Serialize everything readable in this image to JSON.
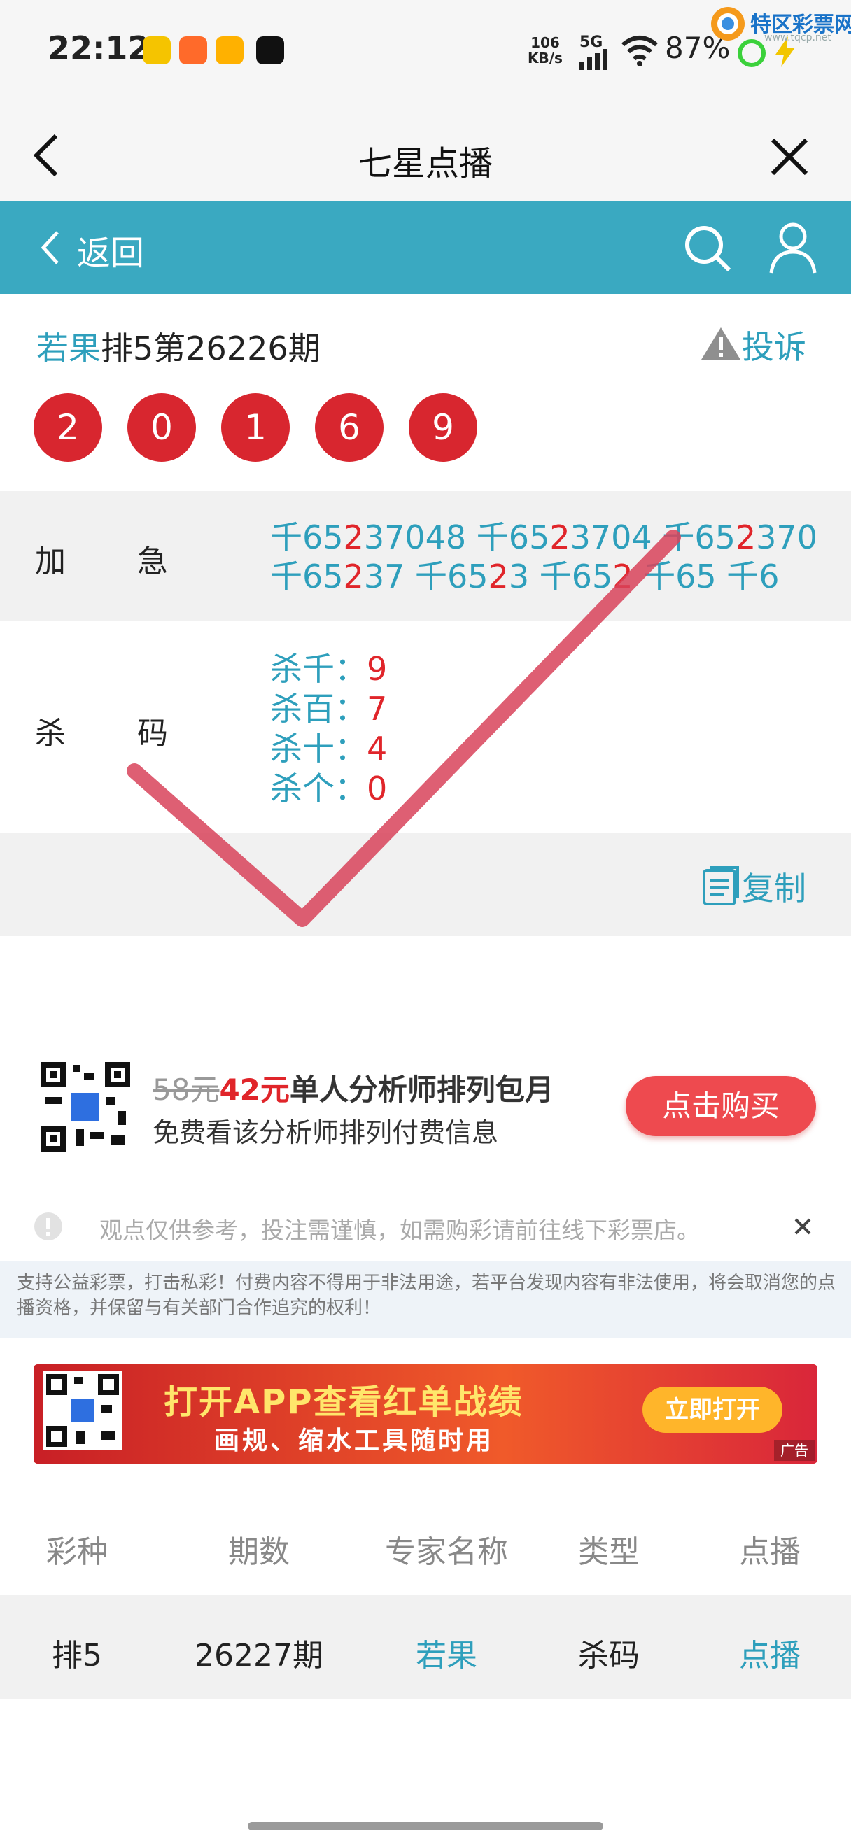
{
  "status_bar": {
    "time": "22:12",
    "speed_value": "106",
    "speed_unit": "KB/s",
    "network": "5G",
    "battery": "87%"
  },
  "watermark": {
    "title": "特区彩票网",
    "url": "www.tqcp.net"
  },
  "titlebar": {
    "title": "七星点播"
  },
  "nav": {
    "back_label": "返回"
  },
  "header": {
    "expert": "若果",
    "issue": "排5第26226期",
    "complaint_label": "投诉",
    "balls": [
      "2",
      "0",
      "1",
      "6",
      "9"
    ]
  },
  "jiaji": {
    "label1": "加",
    "label2": "急",
    "line1": [
      {
        "t": "千65",
        "c": "b"
      },
      {
        "t": "2",
        "c": "r"
      },
      {
        "t": "37048 ",
        "c": "b"
      },
      {
        "t": "千65",
        "c": "b"
      },
      {
        "t": "2",
        "c": "r"
      },
      {
        "t": "3704 ",
        "c": "b"
      },
      {
        "t": "千65",
        "c": "b"
      },
      {
        "t": "2",
        "c": "r"
      },
      {
        "t": "370",
        "c": "b"
      }
    ],
    "line2": [
      {
        "t": "千65",
        "c": "b"
      },
      {
        "t": "2",
        "c": "r"
      },
      {
        "t": "37 ",
        "c": "b"
      },
      {
        "t": "千65",
        "c": "b"
      },
      {
        "t": "2",
        "c": "r"
      },
      {
        "t": "3 ",
        "c": "b"
      },
      {
        "t": "千65",
        "c": "b"
      },
      {
        "t": "2",
        "c": "r"
      },
      {
        "t": " 千65 千6",
        "c": "b"
      }
    ]
  },
  "shama": {
    "label1": "杀",
    "label2": "码",
    "rows": [
      {
        "key": "杀千：",
        "val": "9"
      },
      {
        "key": "杀百：",
        "val": "7"
      },
      {
        "key": "杀十：",
        "val": "4"
      },
      {
        "key": "杀个：",
        "val": "0"
      }
    ]
  },
  "copy_label": "复制",
  "promo": {
    "old_price": "58元",
    "new_price": "42元",
    "title": "单人分析师排列包月",
    "subtitle": "免费看该分析师排列付费信息",
    "buy_label": "点击购买"
  },
  "disclaimer": "观点仅供参考，投注需谨慎，如需购彩请前往线下彩票店。",
  "legal": "支持公益彩票，打击私彩！付费内容不得用于非法用途，若平台发现内容有非法使用，将会取消您的点播资格，并保留与有关部门合作追究的权利！",
  "banner": {
    "line1": "打开APP查看红单战绩",
    "line2": "画规、缩水工具随时用",
    "open_label": "立即打开",
    "ad_tag": "广告"
  },
  "table": {
    "headers": [
      "彩种",
      "期数",
      "专家名称",
      "类型",
      "点播"
    ],
    "row": [
      "排5",
      "26227期",
      "若果",
      "杀码",
      "点播"
    ]
  },
  "colors": {
    "teal": "#3aa9c1",
    "red": "#e0252a",
    "blue_text": "#2e9fbc"
  }
}
